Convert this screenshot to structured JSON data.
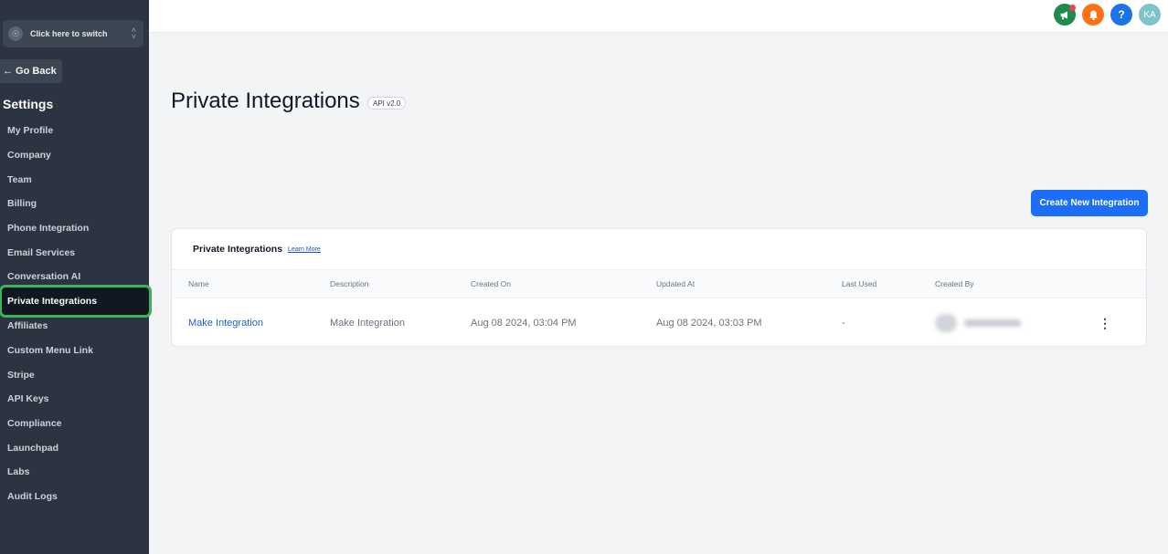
{
  "sidebar": {
    "switcher_label": "Click here to switch",
    "go_back_label": "← Go Back",
    "settings_title": "Settings",
    "items": [
      {
        "label": "My Profile"
      },
      {
        "label": "Company"
      },
      {
        "label": "Team"
      },
      {
        "label": "Billing"
      },
      {
        "label": "Phone Integration"
      },
      {
        "label": "Email Services"
      },
      {
        "label": "Conversation AI"
      },
      {
        "label": "Private Integrations",
        "active": true
      },
      {
        "label": "Affiliates"
      },
      {
        "label": "Custom Menu Link"
      },
      {
        "label": "Stripe"
      },
      {
        "label": "API Keys"
      },
      {
        "label": "Compliance"
      },
      {
        "label": "Launchpad"
      },
      {
        "label": "Labs"
      },
      {
        "label": "Audit Logs"
      }
    ]
  },
  "topbar": {
    "icons": [
      "megaphone-icon",
      "bell-icon",
      "help-icon"
    ],
    "avatar_initials": "KA",
    "help_glyph": "?"
  },
  "main": {
    "page_title": "Private Integrations",
    "api_badge": "API v2.0",
    "create_button_label": "Create New Integration",
    "card": {
      "title": "Private Integrations",
      "learn_more": "Learn More",
      "columns": [
        "Name",
        "Description",
        "Created On",
        "Updated At",
        "Last Used",
        "Created By"
      ],
      "rows": [
        {
          "name": "Make Integration",
          "description": "Make Integration",
          "created_on": "Aug 08 2024, 03:04 PM",
          "updated_at": "Aug 08 2024, 03:03 PM",
          "last_used": "-"
        }
      ]
    }
  },
  "colors": {
    "sidebar_bg": "#2b3440",
    "active_outline": "#3bb55b",
    "primary_button": "#1b6ef5",
    "link": "#1d5fd6"
  }
}
